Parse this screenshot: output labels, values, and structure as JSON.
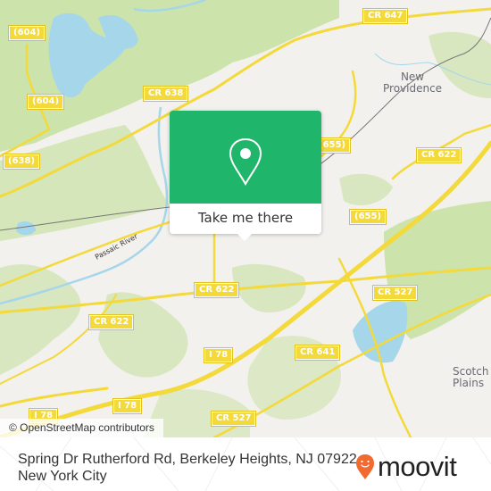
{
  "map": {
    "road_shields": [
      {
        "id": "cr647",
        "label": "CR 647"
      },
      {
        "id": "604-top",
        "label": "(604)"
      },
      {
        "id": "604-mid",
        "label": "(604)"
      },
      {
        "id": "cr638",
        "label": "CR 638"
      },
      {
        "id": "638",
        "label": "(638)"
      },
      {
        "id": "655-top",
        "label": "(655)"
      },
      {
        "id": "cr622-right",
        "label": "CR 622"
      },
      {
        "id": "655-mid",
        "label": "(655)"
      },
      {
        "id": "cr622-center",
        "label": "CR 622"
      },
      {
        "id": "cr527-right",
        "label": "CR 527"
      },
      {
        "id": "cr622-left",
        "label": "CR 622"
      },
      {
        "id": "cr641",
        "label": "CR 641"
      },
      {
        "id": "i78-mid",
        "label": "I 78"
      },
      {
        "id": "i78-low",
        "label": "I 78"
      },
      {
        "id": "i78-left",
        "label": "I 78"
      },
      {
        "id": "cr527-bottom",
        "label": "CR 527"
      }
    ],
    "places": [
      {
        "id": "new-providence",
        "label": "New\nProvidence"
      },
      {
        "id": "scotch-plains",
        "label": "Scotch\nPlains"
      }
    ],
    "waterways": [
      {
        "id": "passaic-river",
        "label": "Passaic River"
      }
    ],
    "colors": {
      "land": "#f2f1ee",
      "wood": "#cde3ac",
      "water": "#a5d6ea",
      "road": "#f4d93a"
    }
  },
  "popup": {
    "icon": "location-pin-icon",
    "button_label": "Take me there",
    "color": "#1fb56a"
  },
  "attribution": "© OpenStreetMap contributors",
  "footer": {
    "address": "Spring Dr Rutherford Rd, Berkeley Heights, NJ 07922, New York City",
    "brand": "moovit",
    "brand_color": "#f26a30"
  }
}
